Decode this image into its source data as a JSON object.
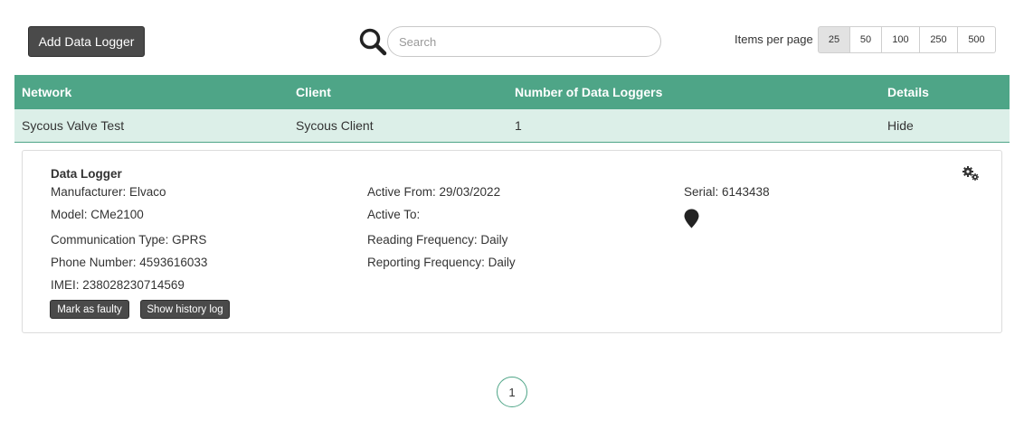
{
  "toolbar": {
    "add_button": "Add Data Logger",
    "search_placeholder": "Search",
    "search_value": "",
    "items_per_page_label": "Items per page",
    "items_per_page_options": [
      "25",
      "50",
      "100",
      "250",
      "500"
    ],
    "items_per_page_selected": "25"
  },
  "table": {
    "headers": [
      "Network",
      "Client",
      "Number of Data Loggers",
      "Details"
    ],
    "rows": [
      {
        "network": "Sycous Valve Test",
        "client": "Sycous Client",
        "count": "1",
        "details": "Hide"
      }
    ]
  },
  "detail": {
    "title": "Data Logger",
    "manufacturer": "Manufacturer: Elvaco",
    "model": "Model: CMe2100",
    "communication_type": "Communication Type: GPRS",
    "phone_number": "Phone Number: 4593616033",
    "imei": "IMEI: 238028230714569",
    "active_from": "Active From: 29/03/2022",
    "active_to": "Active To:",
    "reading_frequency": "Reading Frequency: Daily",
    "reporting_frequency": "Reporting Frequency: Daily",
    "serial": "Serial: 6143438",
    "mark_faulty_button": "Mark as faulty",
    "history_button": "Show history log",
    "icons": {
      "settings": "gears-icon",
      "location": "map-pin-icon"
    }
  },
  "pagination": {
    "pages": [
      "1"
    ],
    "current": "1"
  },
  "colors": {
    "accent": "#4ea587",
    "row_bg": "#dcefe8",
    "button_dark": "#4a4a4a"
  }
}
